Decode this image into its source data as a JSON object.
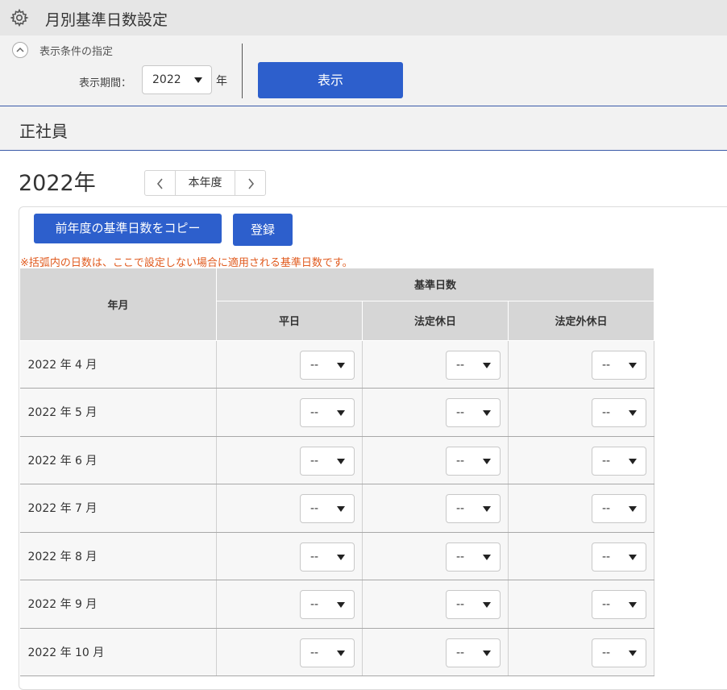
{
  "header": {
    "title": "月別基準日数設定",
    "icon": "gear-icon"
  },
  "filter": {
    "condition_label": "表示条件の指定",
    "period_label": "表示期間：",
    "year_value": "2022",
    "year_unit": "年",
    "show_button": "表示"
  },
  "section": {
    "title": "正社員"
  },
  "year_nav": {
    "heading": "2022年",
    "current_label": "本年度"
  },
  "actions": {
    "copy_button": "前年度の基準日数をコピー",
    "register_button": "登録"
  },
  "note": "※括弧内の日数は、ここで設定しない場合に適用される基準日数です。",
  "table": {
    "col_month": "年月",
    "col_group": "基準日数",
    "cols": [
      "平日",
      "法定休日",
      "法定外休日"
    ],
    "rows": [
      {
        "month": "2022 年 4 月",
        "values": [
          "--",
          "--",
          "--"
        ]
      },
      {
        "month": "2022 年 5 月",
        "values": [
          "--",
          "--",
          "--"
        ]
      },
      {
        "month": "2022 年 6 月",
        "values": [
          "--",
          "--",
          "--"
        ]
      },
      {
        "month": "2022 年 7 月",
        "values": [
          "--",
          "--",
          "--"
        ]
      },
      {
        "month": "2022 年 8 月",
        "values": [
          "--",
          "--",
          "--"
        ]
      },
      {
        "month": "2022 年 9 月",
        "values": [
          "--",
          "--",
          "--"
        ]
      },
      {
        "month": "2022 年 10 月",
        "values": [
          "--",
          "--",
          "--"
        ]
      }
    ]
  },
  "colors": {
    "primary": "#2d5fcc",
    "note": "#e05a1e",
    "divider": "#3a5aa8",
    "header_bg": "#d6d6d6"
  }
}
